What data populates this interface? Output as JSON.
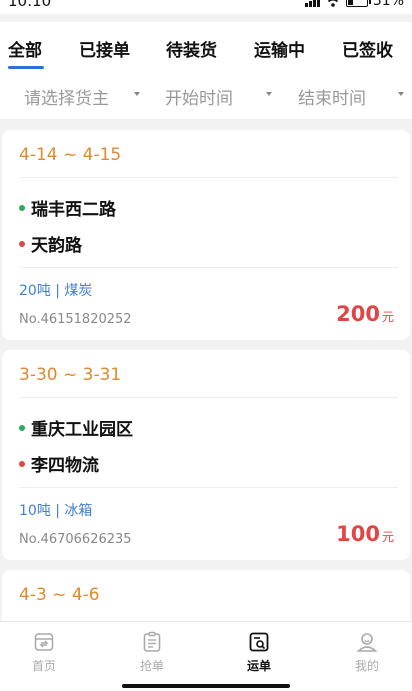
{
  "status_bar": {
    "time": "10:10",
    "battery_text": "31%",
    "battery_level": 0.31
  },
  "tabs": [
    {
      "label": "全部",
      "active": true
    },
    {
      "label": "已接单",
      "active": false
    },
    {
      "label": "待装货",
      "active": false
    },
    {
      "label": "运输中",
      "active": false
    },
    {
      "label": "已签收",
      "active": false
    }
  ],
  "filters": [
    {
      "placeholder": "请选择货主"
    },
    {
      "placeholder": "开始时间"
    },
    {
      "placeholder": "结束时间"
    }
  ],
  "orders": [
    {
      "date_range": "4-14 ~ 4-15",
      "origin": "瑞丰西二路",
      "destination": "天韵路",
      "cargo": "20吨 | 煤炭",
      "order_no": "No.46151820252",
      "price": "200",
      "price_unit": "元"
    },
    {
      "date_range": "3-30 ~ 3-31",
      "origin": "重庆工业园区",
      "destination": "李四物流",
      "cargo": "10吨 | 冰箱",
      "order_no": "No.46706626235",
      "price": "100",
      "price_unit": "元"
    },
    {
      "date_range": "4-3 ~ 4-6"
    }
  ],
  "bottom_nav": [
    {
      "label": "首页",
      "icon": "home-box-icon",
      "active": false
    },
    {
      "label": "抢单",
      "icon": "clipboard-icon",
      "active": false
    },
    {
      "label": "运单",
      "icon": "waybill-search-icon",
      "active": true
    },
    {
      "label": "我的",
      "icon": "user-icon",
      "active": false
    }
  ],
  "colors": {
    "accent": "#2f6fd8",
    "date": "#e08a2a",
    "price": "#e04646",
    "cargo": "#3f7fd6",
    "origin_dot": "#2eaa5c",
    "destination_dot": "#e04646"
  }
}
